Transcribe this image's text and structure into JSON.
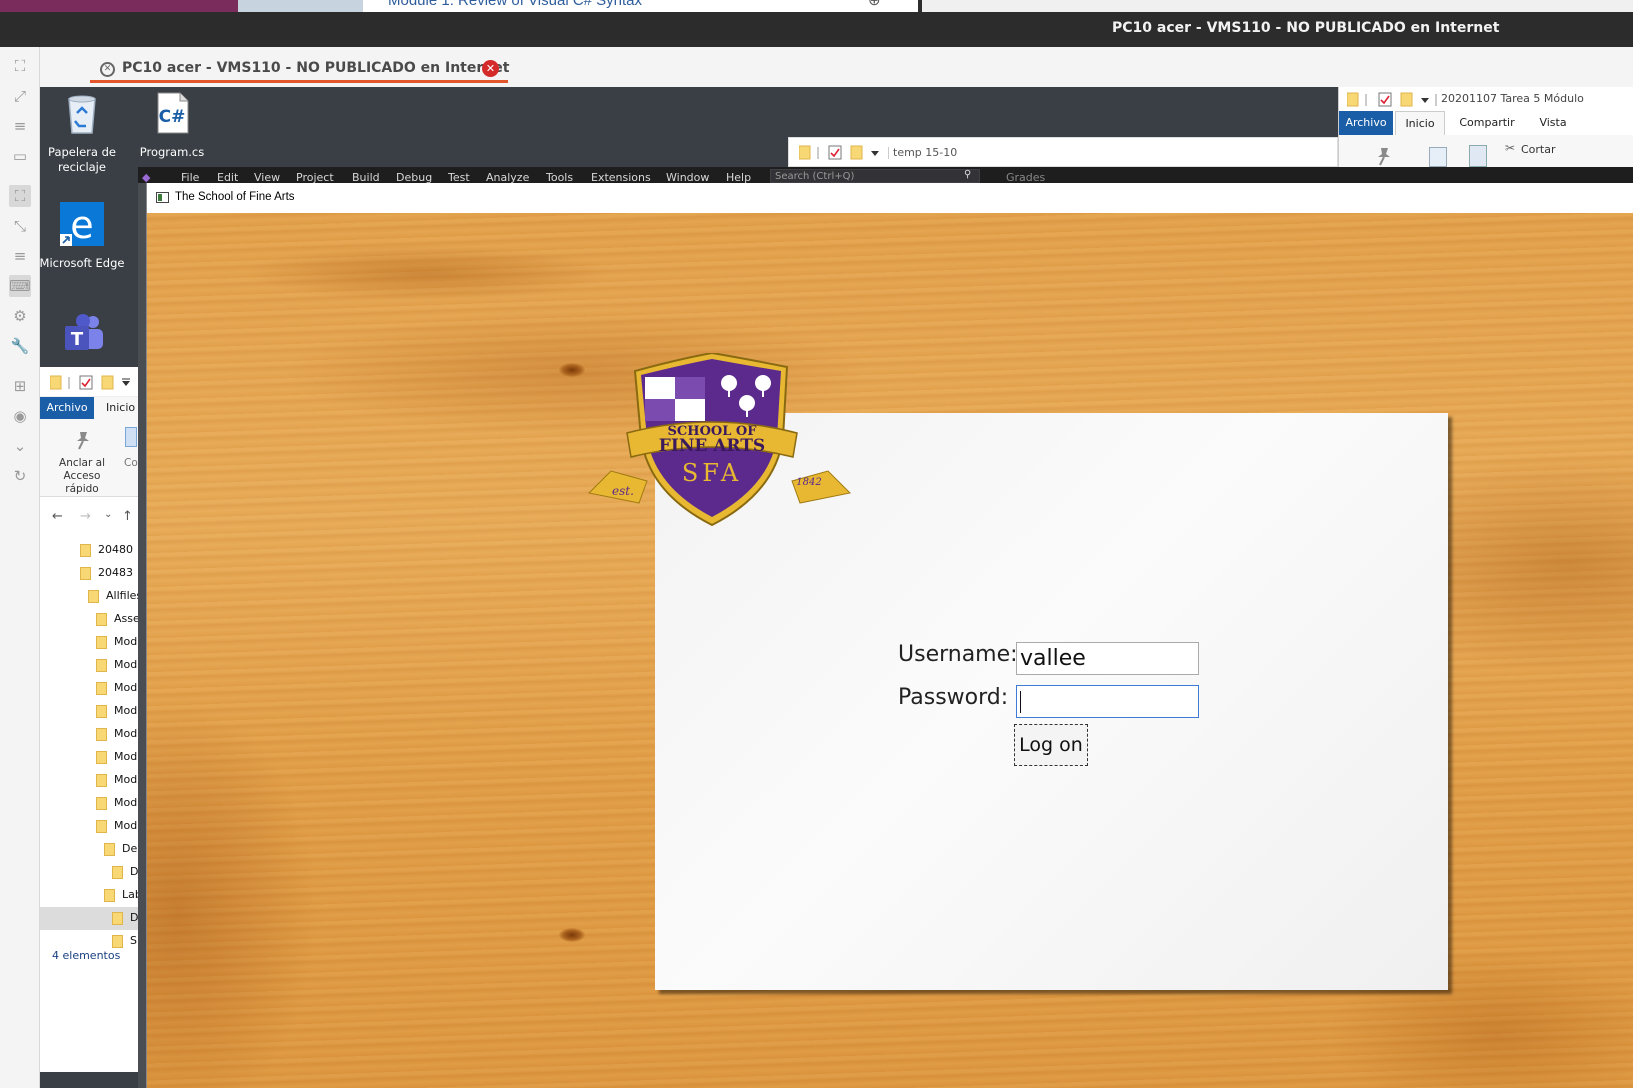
{
  "host": {
    "browser_tab_title": "Module 1: Review of Visual C# Syntax",
    "new_tab_symbol": "⊕",
    "window_title": "PC10 acer - VMS110 - NO PUBLICADO en Internet"
  },
  "viewer": {
    "tab_title": "PC10 acer - VMS110 - NO PUBLICADO en Internet",
    "close_symbol": "✕"
  },
  "desktop": {
    "icons": [
      {
        "label": "Papelera de reciclaje",
        "icon": "recycle-bin-icon"
      },
      {
        "label": "Program.cs",
        "icon": "csharp-file-icon"
      },
      {
        "label": "Microsoft Edge",
        "icon": "edge-icon"
      },
      {
        "label": "",
        "icon": "teams-icon"
      }
    ]
  },
  "explorer_left": {
    "tabs": [
      "Archivo",
      "Inicio"
    ],
    "pin_label": "Anclar al Acceso rápido",
    "copy_label_fragment": "Co",
    "tree": [
      "20480",
      "20483",
      "Allfiles",
      "Asse",
      "Mod",
      "Mod",
      "Mod",
      "Mod",
      "Mod",
      "Mod",
      "Mod",
      "Mod",
      "Mod",
      "Der",
      "D",
      "Lab",
      "D",
      "S"
    ],
    "status": "4 elementos"
  },
  "explorer_mid": {
    "title": "temp 15-10"
  },
  "explorer_right": {
    "title": "20201107 Tarea 5 Módulo",
    "tabs": [
      "Archivo",
      "Inicio",
      "Compartir",
      "Vista"
    ],
    "cut_label": "Cortar"
  },
  "vs_menu": {
    "items": [
      "File",
      "Edit",
      "View",
      "Project",
      "Build",
      "Debug",
      "Test",
      "Analyze",
      "Tools",
      "Extensions",
      "Window",
      "Help"
    ],
    "search_placeholder": "Search (Ctrl+Q)",
    "extra": "Grades"
  },
  "app": {
    "window_title": "The School of Fine Arts",
    "crest": {
      "line1": "SCHOOL OF",
      "line2": "FINE ARTS",
      "monogram": "SFA",
      "est": "est.",
      "year": "1842"
    },
    "login": {
      "username_label": "Username:",
      "username_value": "vallee",
      "password_label": "Password:",
      "password_value": "",
      "logon_label": "Log on"
    }
  },
  "colors": {
    "accent_blue": "#1a5ea8",
    "tab_underline": "#e2562c",
    "close_red": "#d42a2a",
    "crest_purple": "#5b2a8c",
    "crest_gold": "#e8b833"
  }
}
